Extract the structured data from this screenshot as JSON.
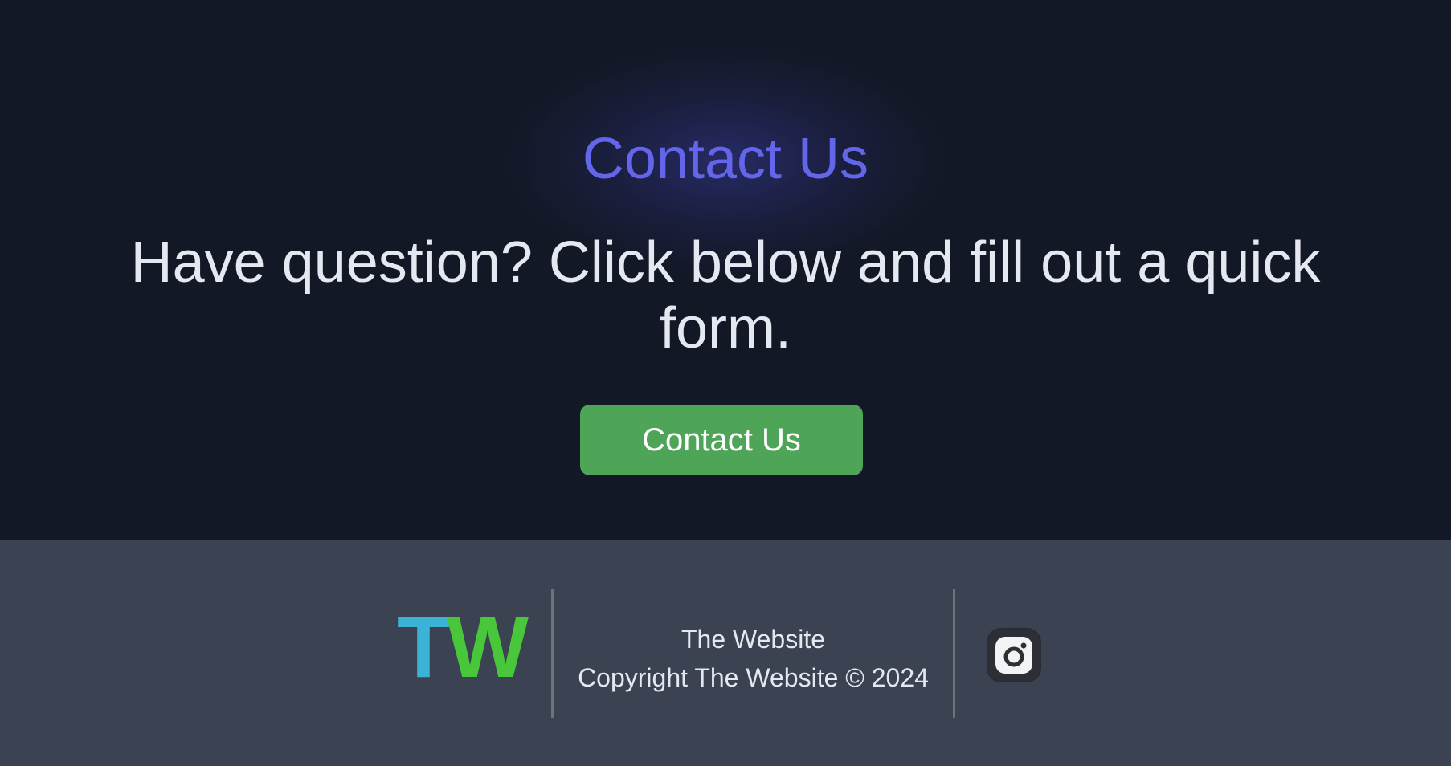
{
  "hero": {
    "title": "Contact Us",
    "subtitle": "Have question? Click below and fill out a quick form.",
    "button_label": "Contact Us"
  },
  "footer": {
    "logo": {
      "letter_1": "T",
      "letter_2": "W"
    },
    "site_name": "The Website",
    "copyright": "Copyright The Website © 2024",
    "social": {
      "icon": "instagram-icon"
    }
  },
  "colors": {
    "background": "#131826",
    "footer_background": "#3b4252",
    "title_accent": "#6366ea",
    "button_green": "#4ea457",
    "logo_blue": "#3bb3d6",
    "logo_green": "#48c73b",
    "text_light": "#e5e8f1"
  }
}
